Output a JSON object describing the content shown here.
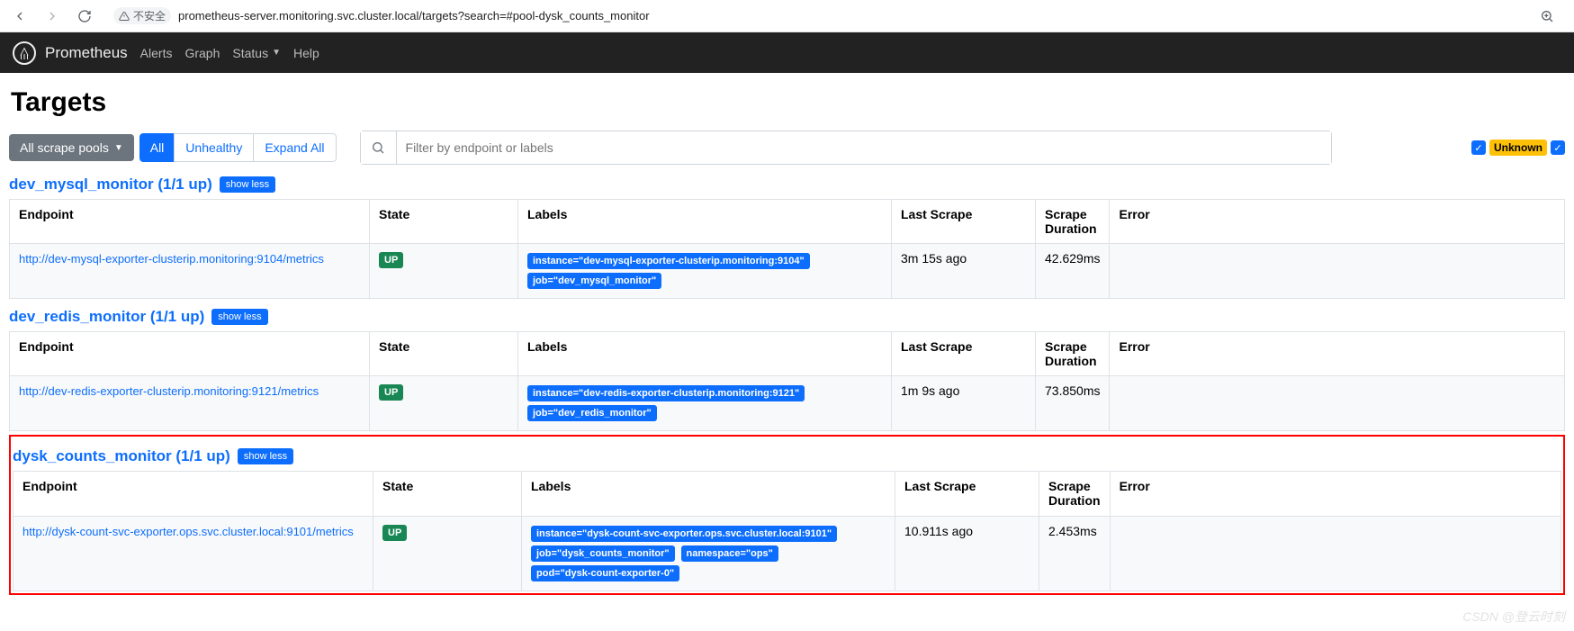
{
  "browser": {
    "url": "prometheus-server.monitoring.svc.cluster.local/targets?search=#pool-dysk_counts_monitor",
    "security_label": "不安全"
  },
  "nav": {
    "brand": "Prometheus",
    "links": {
      "alerts": "Alerts",
      "graph": "Graph",
      "status": "Status",
      "help": "Help"
    }
  },
  "page": {
    "title": "Targets"
  },
  "toolbar": {
    "pool_selector": "All scrape pools",
    "filters": {
      "all": "All",
      "unhealthy": "Unhealthy",
      "expand": "Expand All"
    },
    "search_placeholder": "Filter by endpoint or labels",
    "unknown_badge": "Unknown"
  },
  "columns": {
    "endpoint": "Endpoint",
    "state": "State",
    "labels": "Labels",
    "last_scrape": "Last Scrape",
    "scrape_duration_l1": "Scrape",
    "scrape_duration_l2": "Duration",
    "error": "Error"
  },
  "toggle": {
    "show_less": "show less"
  },
  "pools": [
    {
      "title": "dev_mysql_monitor (1/1 up)",
      "rows": [
        {
          "endpoint": "http://dev-mysql-exporter-clusterip.monitoring:9104/metrics",
          "state": "UP",
          "labels": [
            "instance=\"dev-mysql-exporter-clusterip.monitoring:9104\"",
            "job=\"dev_mysql_monitor\""
          ],
          "last_scrape": "3m 15s ago",
          "duration": "42.629ms",
          "error": ""
        }
      ]
    },
    {
      "title": "dev_redis_monitor (1/1 up)",
      "rows": [
        {
          "endpoint": "http://dev-redis-exporter-clusterip.monitoring:9121/metrics",
          "state": "UP",
          "labels": [
            "instance=\"dev-redis-exporter-clusterip.monitoring:9121\"",
            "job=\"dev_redis_monitor\""
          ],
          "last_scrape": "1m 9s ago",
          "duration": "73.850ms",
          "error": ""
        }
      ]
    },
    {
      "title": "dysk_counts_monitor (1/1 up)",
      "highlight": true,
      "rows": [
        {
          "endpoint": "http://dysk-count-svc-exporter.ops.svc.cluster.local:9101/metrics",
          "state": "UP",
          "labels": [
            "instance=\"dysk-count-svc-exporter.ops.svc.cluster.local:9101\"",
            "job=\"dysk_counts_monitor\"",
            "namespace=\"ops\"",
            "pod=\"dysk-count-exporter-0\""
          ],
          "last_scrape": "10.911s ago",
          "duration": "2.453ms",
          "error": ""
        }
      ]
    }
  ],
  "watermark": "CSDN @登云时刻"
}
